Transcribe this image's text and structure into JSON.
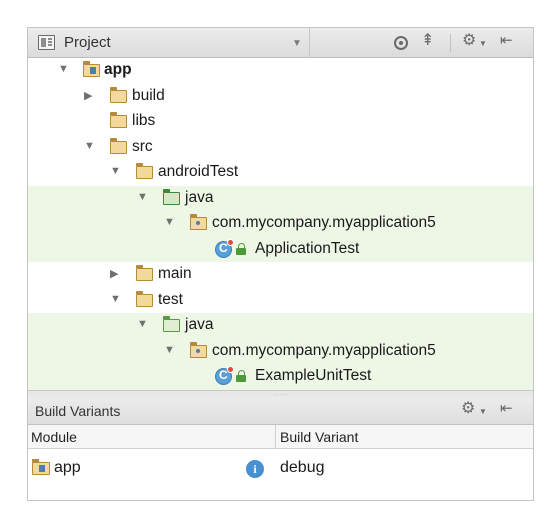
{
  "project_header": {
    "title": "Project",
    "caret": "▼",
    "icons": [
      "locate-target-icon",
      "collapse-all-icon",
      "gear-icon",
      "hide-panel-icon"
    ],
    "gear_caret": "▼"
  },
  "tree": {
    "rows": [
      {
        "label": "app",
        "bold": true,
        "expanded": true,
        "icon": "module-folder-icon"
      },
      {
        "label": "build",
        "expanded": false,
        "icon": "folder-icon"
      },
      {
        "label": "libs",
        "icon": "folder-icon"
      },
      {
        "label": "src",
        "expanded": true,
        "icon": "folder-icon"
      },
      {
        "label": "androidTest",
        "expanded": true,
        "icon": "folder-icon"
      },
      {
        "label": "java",
        "expanded": true,
        "icon": "test-source-folder-icon"
      },
      {
        "label": "com.mycompany.myapplication5",
        "expanded": true,
        "icon": "package-icon"
      },
      {
        "label": "ApplicationTest",
        "icon": "test-class-icon"
      },
      {
        "label": "main",
        "expanded": false,
        "icon": "folder-icon"
      },
      {
        "label": "test",
        "expanded": true,
        "icon": "folder-icon"
      },
      {
        "label": "java",
        "expanded": true,
        "icon": "test-source-folder-icon"
      },
      {
        "label": "com.mycompany.myapplication5",
        "expanded": true,
        "icon": "package-icon"
      },
      {
        "label": "ExampleUnitTest",
        "icon": "test-class-icon"
      }
    ]
  },
  "build_variants": {
    "title": "Build Variants",
    "columns": {
      "module": "Module",
      "variant": "Build Variant"
    },
    "rows": [
      {
        "module": "app",
        "variant": "debug"
      }
    ]
  },
  "colors": {
    "highlight": "#eef6e6",
    "folder": "#f3d99a",
    "info": "#4a90d0"
  }
}
